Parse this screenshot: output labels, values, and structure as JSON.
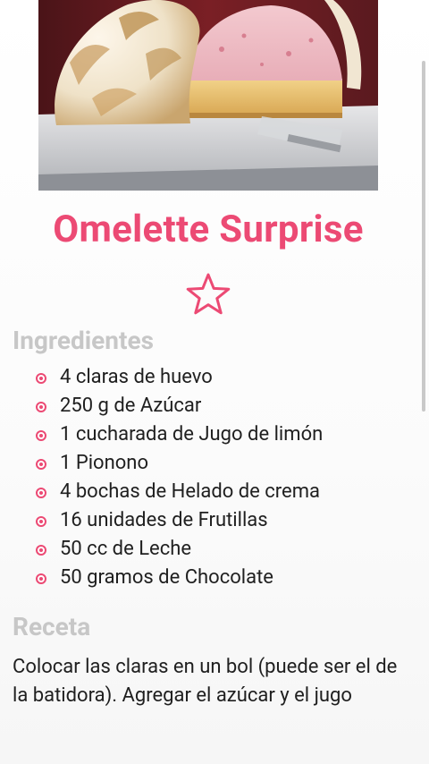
{
  "recipe": {
    "title": "Omelette Surprise",
    "accent_color": "#ec4a74",
    "favorite_icon": "star-outline-icon",
    "hero_image": "baked-alaska-dessert-photo"
  },
  "ingredients": {
    "heading": "Ingredientes",
    "bullet_icon": "circle-bullet-icon",
    "items": [
      "4 claras de huevo",
      "250 g de Azúcar",
      "1 cucharada de Jugo de limón",
      "1 Pionono",
      "4 bochas de Helado de crema",
      "16 unidades de Frutillas",
      "50 cc de Leche",
      "50 gramos de Chocolate"
    ]
  },
  "receta": {
    "heading": "Receta",
    "text": "Colocar las claras en un bol (puede ser el de la batidora). Agregar el azúcar y el jugo"
  }
}
